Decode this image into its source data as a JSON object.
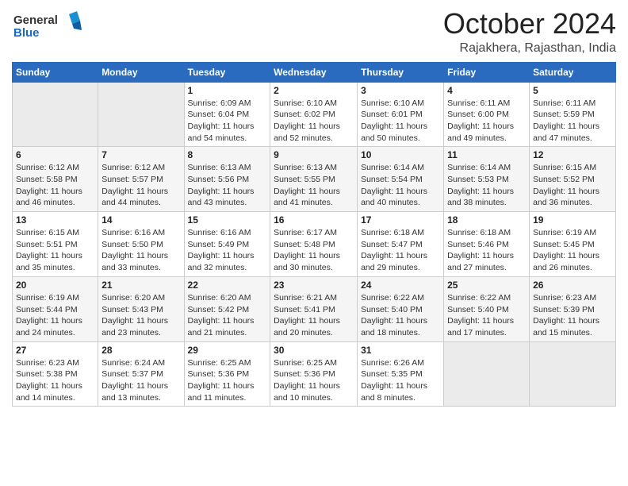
{
  "logo": {
    "general": "General",
    "blue": "Blue"
  },
  "title": "October 2024",
  "subtitle": "Rajakhera, Rajasthan, India",
  "days_of_week": [
    "Sunday",
    "Monday",
    "Tuesday",
    "Wednesday",
    "Thursday",
    "Friday",
    "Saturday"
  ],
  "weeks": [
    [
      {
        "day": "",
        "info": ""
      },
      {
        "day": "",
        "info": ""
      },
      {
        "day": "1",
        "sunrise": "Sunrise: 6:09 AM",
        "sunset": "Sunset: 6:04 PM",
        "daylight": "Daylight: 11 hours and 54 minutes."
      },
      {
        "day": "2",
        "sunrise": "Sunrise: 6:10 AM",
        "sunset": "Sunset: 6:02 PM",
        "daylight": "Daylight: 11 hours and 52 minutes."
      },
      {
        "day": "3",
        "sunrise": "Sunrise: 6:10 AM",
        "sunset": "Sunset: 6:01 PM",
        "daylight": "Daylight: 11 hours and 50 minutes."
      },
      {
        "day": "4",
        "sunrise": "Sunrise: 6:11 AM",
        "sunset": "Sunset: 6:00 PM",
        "daylight": "Daylight: 11 hours and 49 minutes."
      },
      {
        "day": "5",
        "sunrise": "Sunrise: 6:11 AM",
        "sunset": "Sunset: 5:59 PM",
        "daylight": "Daylight: 11 hours and 47 minutes."
      }
    ],
    [
      {
        "day": "6",
        "sunrise": "Sunrise: 6:12 AM",
        "sunset": "Sunset: 5:58 PM",
        "daylight": "Daylight: 11 hours and 46 minutes."
      },
      {
        "day": "7",
        "sunrise": "Sunrise: 6:12 AM",
        "sunset": "Sunset: 5:57 PM",
        "daylight": "Daylight: 11 hours and 44 minutes."
      },
      {
        "day": "8",
        "sunrise": "Sunrise: 6:13 AM",
        "sunset": "Sunset: 5:56 PM",
        "daylight": "Daylight: 11 hours and 43 minutes."
      },
      {
        "day": "9",
        "sunrise": "Sunrise: 6:13 AM",
        "sunset": "Sunset: 5:55 PM",
        "daylight": "Daylight: 11 hours and 41 minutes."
      },
      {
        "day": "10",
        "sunrise": "Sunrise: 6:14 AM",
        "sunset": "Sunset: 5:54 PM",
        "daylight": "Daylight: 11 hours and 40 minutes."
      },
      {
        "day": "11",
        "sunrise": "Sunrise: 6:14 AM",
        "sunset": "Sunset: 5:53 PM",
        "daylight": "Daylight: 11 hours and 38 minutes."
      },
      {
        "day": "12",
        "sunrise": "Sunrise: 6:15 AM",
        "sunset": "Sunset: 5:52 PM",
        "daylight": "Daylight: 11 hours and 36 minutes."
      }
    ],
    [
      {
        "day": "13",
        "sunrise": "Sunrise: 6:15 AM",
        "sunset": "Sunset: 5:51 PM",
        "daylight": "Daylight: 11 hours and 35 minutes."
      },
      {
        "day": "14",
        "sunrise": "Sunrise: 6:16 AM",
        "sunset": "Sunset: 5:50 PM",
        "daylight": "Daylight: 11 hours and 33 minutes."
      },
      {
        "day": "15",
        "sunrise": "Sunrise: 6:16 AM",
        "sunset": "Sunset: 5:49 PM",
        "daylight": "Daylight: 11 hours and 32 minutes."
      },
      {
        "day": "16",
        "sunrise": "Sunrise: 6:17 AM",
        "sunset": "Sunset: 5:48 PM",
        "daylight": "Daylight: 11 hours and 30 minutes."
      },
      {
        "day": "17",
        "sunrise": "Sunrise: 6:18 AM",
        "sunset": "Sunset: 5:47 PM",
        "daylight": "Daylight: 11 hours and 29 minutes."
      },
      {
        "day": "18",
        "sunrise": "Sunrise: 6:18 AM",
        "sunset": "Sunset: 5:46 PM",
        "daylight": "Daylight: 11 hours and 27 minutes."
      },
      {
        "day": "19",
        "sunrise": "Sunrise: 6:19 AM",
        "sunset": "Sunset: 5:45 PM",
        "daylight": "Daylight: 11 hours and 26 minutes."
      }
    ],
    [
      {
        "day": "20",
        "sunrise": "Sunrise: 6:19 AM",
        "sunset": "Sunset: 5:44 PM",
        "daylight": "Daylight: 11 hours and 24 minutes."
      },
      {
        "day": "21",
        "sunrise": "Sunrise: 6:20 AM",
        "sunset": "Sunset: 5:43 PM",
        "daylight": "Daylight: 11 hours and 23 minutes."
      },
      {
        "day": "22",
        "sunrise": "Sunrise: 6:20 AM",
        "sunset": "Sunset: 5:42 PM",
        "daylight": "Daylight: 11 hours and 21 minutes."
      },
      {
        "day": "23",
        "sunrise": "Sunrise: 6:21 AM",
        "sunset": "Sunset: 5:41 PM",
        "daylight": "Daylight: 11 hours and 20 minutes."
      },
      {
        "day": "24",
        "sunrise": "Sunrise: 6:22 AM",
        "sunset": "Sunset: 5:40 PM",
        "daylight": "Daylight: 11 hours and 18 minutes."
      },
      {
        "day": "25",
        "sunrise": "Sunrise: 6:22 AM",
        "sunset": "Sunset: 5:40 PM",
        "daylight": "Daylight: 11 hours and 17 minutes."
      },
      {
        "day": "26",
        "sunrise": "Sunrise: 6:23 AM",
        "sunset": "Sunset: 5:39 PM",
        "daylight": "Daylight: 11 hours and 15 minutes."
      }
    ],
    [
      {
        "day": "27",
        "sunrise": "Sunrise: 6:23 AM",
        "sunset": "Sunset: 5:38 PM",
        "daylight": "Daylight: 11 hours and 14 minutes."
      },
      {
        "day": "28",
        "sunrise": "Sunrise: 6:24 AM",
        "sunset": "Sunset: 5:37 PM",
        "daylight": "Daylight: 11 hours and 13 minutes."
      },
      {
        "day": "29",
        "sunrise": "Sunrise: 6:25 AM",
        "sunset": "Sunset: 5:36 PM",
        "daylight": "Daylight: 11 hours and 11 minutes."
      },
      {
        "day": "30",
        "sunrise": "Sunrise: 6:25 AM",
        "sunset": "Sunset: 5:36 PM",
        "daylight": "Daylight: 11 hours and 10 minutes."
      },
      {
        "day": "31",
        "sunrise": "Sunrise: 6:26 AM",
        "sunset": "Sunset: 5:35 PM",
        "daylight": "Daylight: 11 hours and 8 minutes."
      },
      {
        "day": "",
        "info": ""
      },
      {
        "day": "",
        "info": ""
      }
    ]
  ]
}
